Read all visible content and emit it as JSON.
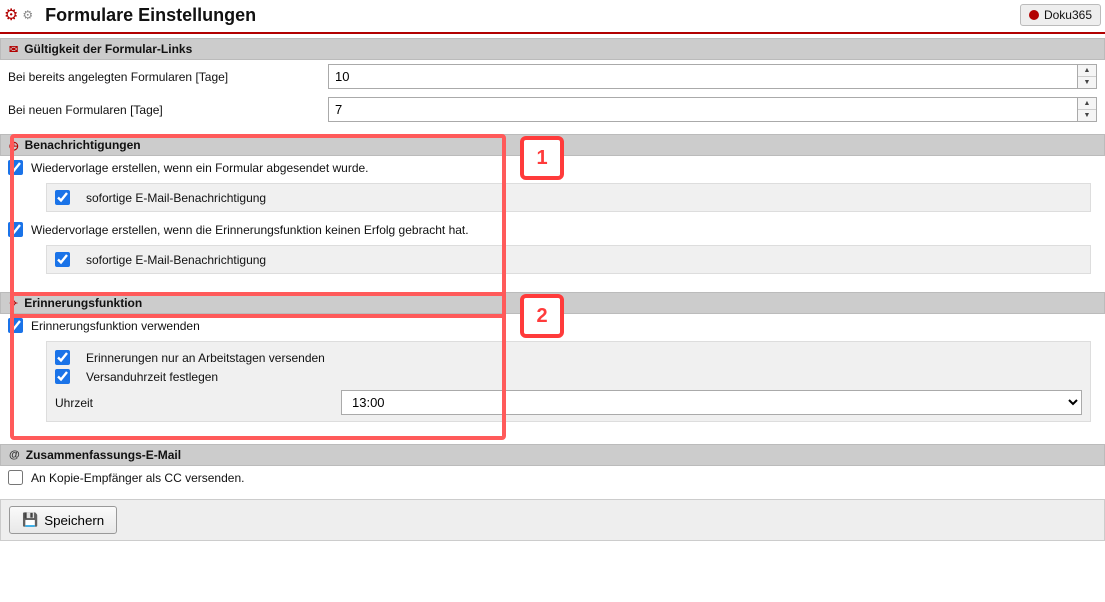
{
  "header": {
    "title": "Formulare Einstellungen",
    "doku_label": "Doku365"
  },
  "validity": {
    "header": "Gültigkeit der Formular-Links",
    "existing_label": "Bei bereits angelegten Formularen [Tage]",
    "existing_value": "10",
    "new_label": "Bei neuen Formularen [Tage]",
    "new_value": "7"
  },
  "notifications": {
    "header": "Benachrichtigungen",
    "on_submit_label": "Wiedervorlage erstellen, wenn ein Formular abgesendet wurde.",
    "immediate_email_label": "sofortige E-Mail-Benachrichtigung",
    "on_reminder_fail_label": "Wiedervorlage erstellen, wenn die Erinnerungsfunktion keinen Erfolg gebracht hat."
  },
  "reminder": {
    "header": "Erinnerungsfunktion",
    "use_label": "Erinnerungsfunktion verwenden",
    "workdays_label": "Erinnerungen nur an Arbeitstagen versenden",
    "set_time_label": "Versanduhrzeit festlegen",
    "time_label": "Uhrzeit",
    "time_value": "13:00"
  },
  "summary": {
    "header": "Zusammenfassungs-E-Mail",
    "cc_label": "An Kopie-Empfänger als CC versenden."
  },
  "footer": {
    "save_label": "Speichern"
  },
  "callouts": {
    "one": "1",
    "two": "2"
  }
}
